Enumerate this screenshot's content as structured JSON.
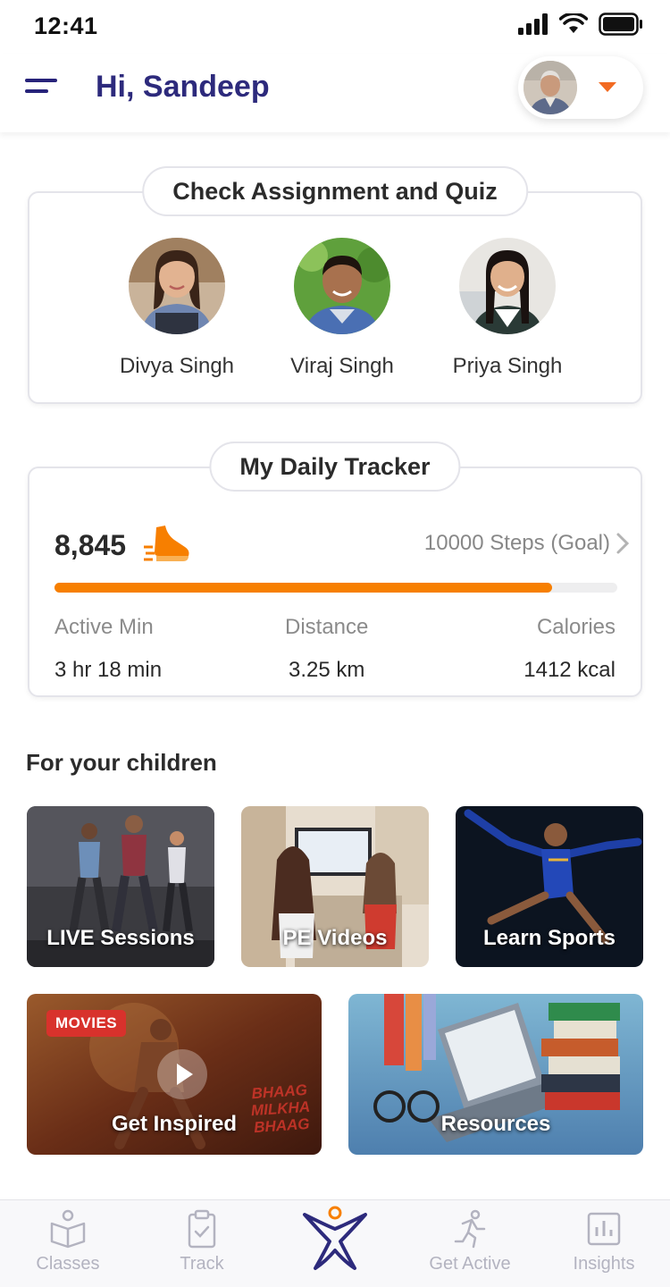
{
  "status_bar": {
    "time": "12:41"
  },
  "header": {
    "greeting": "Hi, Sandeep",
    "menu_icon": "hamburger-icon",
    "dropdown_icon": "caret-down-icon"
  },
  "assignment_card": {
    "title": "Check Assignment and Quiz",
    "children": [
      {
        "name": "Divya Singh"
      },
      {
        "name": "Viraj Singh"
      },
      {
        "name": "Priya Singh"
      }
    ]
  },
  "tracker": {
    "title": "My Daily Tracker",
    "steps": "8,845",
    "goal": "10000 Steps (Goal)",
    "progress_fraction": 0.8845,
    "stats": [
      {
        "label": "Active Min",
        "value": "3 hr 18 min"
      },
      {
        "label": "Distance",
        "value": "3.25 km"
      },
      {
        "label": "Calories",
        "value": "1412 kcal"
      }
    ]
  },
  "section": {
    "title": "For your children"
  },
  "tiles": [
    {
      "label": "LIVE Sessions"
    },
    {
      "label": "PE Videos"
    },
    {
      "label": "Learn Sports"
    },
    {
      "label": "Get Inspired",
      "badge": "MOVIES",
      "movie_title": "BHAAG MILKHA BHAAG"
    },
    {
      "label": "Resources"
    }
  ],
  "bottom_nav": [
    {
      "label": "Classes",
      "icon": "book-icon"
    },
    {
      "label": "Track",
      "icon": "clipboard-check-icon"
    },
    {
      "label": "",
      "icon": "brand-logo-icon"
    },
    {
      "label": "Get Active",
      "icon": "running-icon"
    },
    {
      "label": "Insights",
      "icon": "bar-chart-icon"
    }
  ],
  "colors": {
    "brand": "#2d2a7c",
    "accent": "#f77f00",
    "badge": "#d8322c"
  }
}
